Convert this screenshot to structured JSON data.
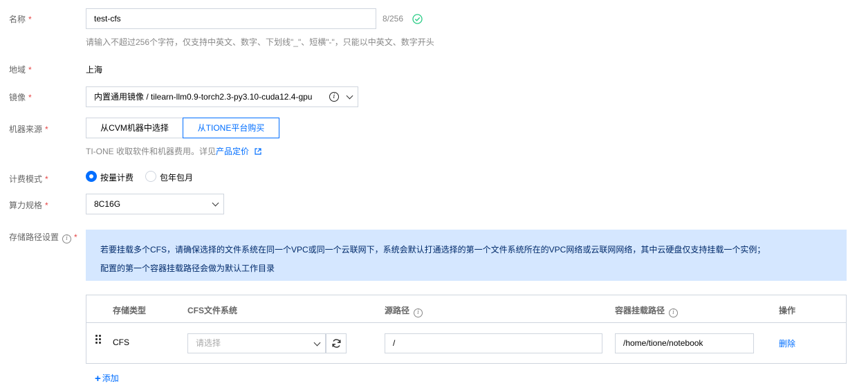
{
  "form": {
    "name": {
      "label": "名称",
      "value": "test-cfs",
      "counter": "8/256",
      "hint": "请输入不超过256个字符，仅支持中英文、数字、下划线\"_\"、短横\"-\"，只能以中英文、数字开头"
    },
    "region": {
      "label": "地域",
      "value": "上海"
    },
    "image": {
      "label": "镜像",
      "value": "内置通用镜像 / tilearn-llm0.9-torch2.3-py3.10-cuda12.4-gpu"
    },
    "machine_source": {
      "label": "机器来源",
      "options": [
        "从CVM机器中选择",
        "从TIONE平台购买"
      ],
      "selected": "从TIONE平台购买",
      "hint_prefix": "TI-ONE 收取软件和机器费用。详见",
      "hint_link": "产品定价"
    },
    "billing": {
      "label": "计费模式",
      "options": [
        "按量计费",
        "包年包月"
      ],
      "selected": "按量计费"
    },
    "spec": {
      "label": "算力规格",
      "value": "8C16G"
    },
    "storage": {
      "label": "存储路径设置",
      "notice_line1": "若要挂载多个CFS，请确保选择的文件系统在同一个VPC或同一个云联网下，系统会默认打通选择的第一个文件系统所在的VPC网络或云联网网络，其中云硬盘仅支持挂载一个实例；",
      "notice_line2": "配置的第一个容器挂载路径会做为默认工作目录",
      "columns": [
        "存储类型",
        "CFS文件系统",
        "源路径",
        "容器挂载路径",
        "操作"
      ],
      "rows": [
        {
          "type": "CFS",
          "fs_placeholder": "请选择",
          "source_path": "/",
          "mount_path": "/home/tione/notebook",
          "action": "删除"
        }
      ],
      "add_label": "添加"
    }
  },
  "colors": {
    "accent": "#006eff",
    "required": "#e54545",
    "success": "#29cc85",
    "notice_bg": "#d5e7ff"
  }
}
